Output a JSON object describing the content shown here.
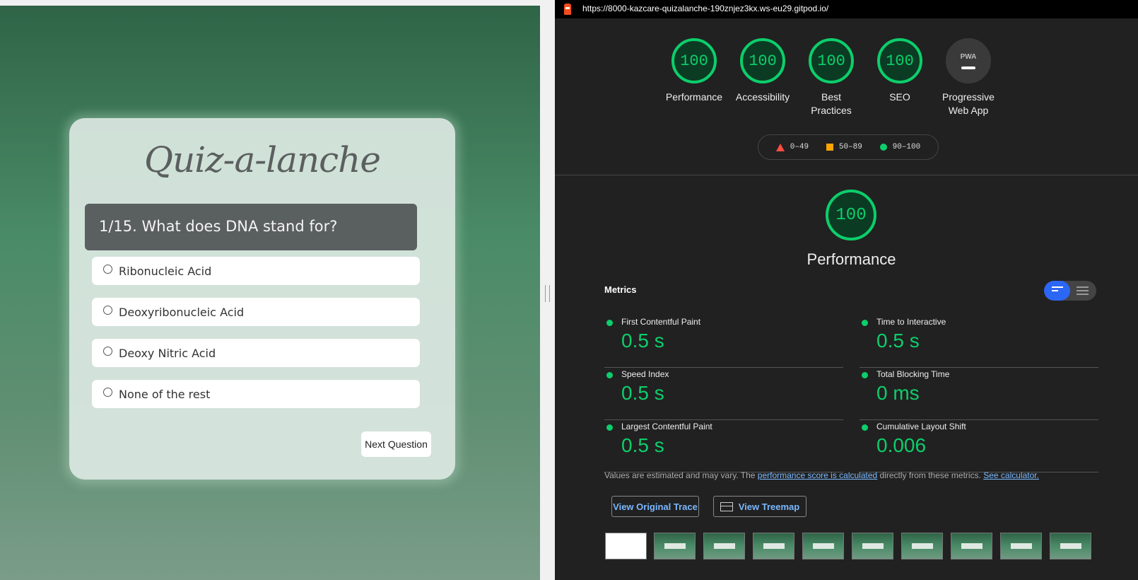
{
  "quiz": {
    "title": "Quiz-a-lanche",
    "question": "1/15. What does DNA stand for?",
    "answers": [
      "Ribonucleic Acid",
      "Deoxyribonucleic Acid",
      "Deoxy Nitric Acid",
      "None of the rest"
    ],
    "next_label": "Next Question"
  },
  "lighthouse": {
    "url": "https://8000-kazcare-quizalanche-190znjez3kx.ws-eu29.gitpod.io/",
    "gauges": [
      {
        "score": "100",
        "label_lines": [
          "Performance"
        ]
      },
      {
        "score": "100",
        "label_lines": [
          "Accessibility"
        ]
      },
      {
        "score": "100",
        "label_lines": [
          "Best",
          "Practices"
        ]
      },
      {
        "score": "100",
        "label_lines": [
          "SEO"
        ]
      },
      {
        "score": "PWA",
        "label_lines": [
          "Progressive",
          "Web App"
        ]
      }
    ],
    "legend": [
      "0–49",
      "50–89",
      "90–100"
    ],
    "colors": {
      "pass": "#0cce6b",
      "average": "#ffa400",
      "fail": "#ff4e42"
    },
    "performance": {
      "score": "100",
      "title": "Performance"
    },
    "metrics_label": "Metrics",
    "metrics": [
      {
        "name": "First Contentful Paint",
        "value": "0.5 s"
      },
      {
        "name": "Time to Interactive",
        "value": "0.5 s"
      },
      {
        "name": "Speed Index",
        "value": "0.5 s"
      },
      {
        "name": "Total Blocking Time",
        "value": "0 ms"
      },
      {
        "name": "Largest Contentful Paint",
        "value": "0.5 s"
      },
      {
        "name": "Cumulative Layout Shift",
        "value": "0.006"
      }
    ],
    "note": {
      "prefix": "Values are estimated and may vary. The ",
      "link1": "performance score is calculated",
      "middle": " directly from these metrics. ",
      "link2": "See calculator."
    },
    "buttons": {
      "trace": "View Original Trace",
      "treemap": "View Treemap"
    }
  }
}
